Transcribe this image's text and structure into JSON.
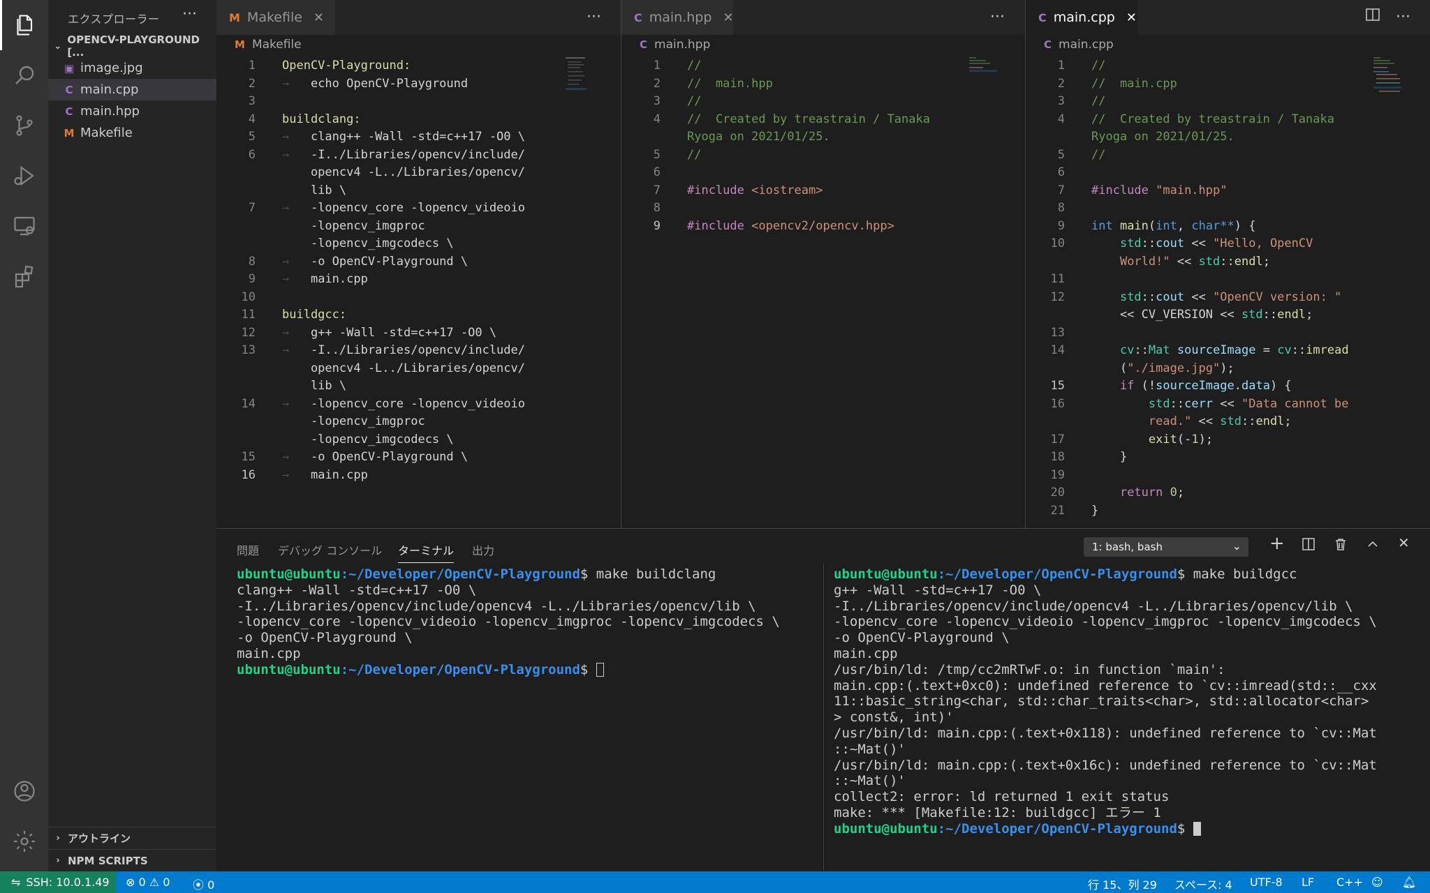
{
  "sidebar": {
    "title": "エクスプローラー",
    "more": "···",
    "folder": "OPENCV-PLAYGROUND [...",
    "files": [
      {
        "name": "image.jpg",
        "icon": "▣",
        "color": "#a074c4"
      },
      {
        "name": "main.cpp",
        "icon": "C",
        "color": "#a074c4"
      },
      {
        "name": "main.hpp",
        "icon": "C",
        "color": "#a074c4"
      },
      {
        "name": "Makefile",
        "icon": "M",
        "color": "#e37933"
      }
    ],
    "sections": [
      "アウトライン",
      "NPM SCRIPTS"
    ]
  },
  "editors": {
    "g1": {
      "tab": "Makefile",
      "tab_icon": "M",
      "breadcrumb": "Makefile"
    },
    "g2": {
      "tab": "main.hpp",
      "tab_icon": "C",
      "breadcrumb": "main.hpp"
    },
    "g3": {
      "tab": "main.cpp",
      "tab_icon": "C",
      "breadcrumb": "main.cpp"
    },
    "more": "···",
    "close": "✕"
  },
  "makefile_lines": [
    {
      "n": "1",
      "parts": [
        [
          "k-label",
          "OpenCV-Playground:"
        ]
      ]
    },
    {
      "n": "2",
      "parts": [
        [
          "k-ws",
          "→   "
        ],
        [
          "k-txt",
          "echo OpenCV-Playground"
        ]
      ]
    },
    {
      "n": "3",
      "parts": []
    },
    {
      "n": "4",
      "parts": [
        [
          "k-label",
          "buildclang:"
        ]
      ]
    },
    {
      "n": "5",
      "parts": [
        [
          "k-ws",
          "→   "
        ],
        [
          "k-txt",
          "clang++ -Wall -std=c++17 -O0 \\"
        ]
      ]
    },
    {
      "n": "6",
      "parts": [
        [
          "k-ws",
          "→   "
        ],
        [
          "k-txt",
          "-I../Libraries/opencv/include/"
        ]
      ]
    },
    {
      "n": "",
      "parts": [
        [
          "k-txt",
          "    opencv4 -L../Libraries/opencv/"
        ]
      ]
    },
    {
      "n": "",
      "parts": [
        [
          "k-txt",
          "    lib \\"
        ]
      ]
    },
    {
      "n": "7",
      "parts": [
        [
          "k-ws",
          "→   "
        ],
        [
          "k-txt",
          "-lopencv_core -lopencv_videoio"
        ]
      ]
    },
    {
      "n": "",
      "parts": [
        [
          "k-txt",
          "    -lopencv_imgproc"
        ]
      ]
    },
    {
      "n": "",
      "parts": [
        [
          "k-txt",
          "    -lopencv_imgcodecs \\"
        ]
      ]
    },
    {
      "n": "8",
      "parts": [
        [
          "k-ws",
          "→   "
        ],
        [
          "k-txt",
          "-o OpenCV-Playground \\"
        ]
      ]
    },
    {
      "n": "9",
      "parts": [
        [
          "k-ws",
          "→   "
        ],
        [
          "k-txt",
          "main.cpp"
        ]
      ]
    },
    {
      "n": "10",
      "parts": []
    },
    {
      "n": "11",
      "parts": [
        [
          "k-label",
          "buildgcc:"
        ]
      ]
    },
    {
      "n": "12",
      "parts": [
        [
          "k-ws",
          "→   "
        ],
        [
          "k-txt",
          "g++ -Wall -std=c++17 -O0 \\"
        ]
      ]
    },
    {
      "n": "13",
      "parts": [
        [
          "k-ws",
          "→   "
        ],
        [
          "k-txt",
          "-I../Libraries/opencv/include/"
        ]
      ]
    },
    {
      "n": "",
      "parts": [
        [
          "k-txt",
          "    opencv4 -L../Libraries/opencv/"
        ]
      ]
    },
    {
      "n": "",
      "parts": [
        [
          "k-txt",
          "    lib \\"
        ]
      ]
    },
    {
      "n": "14",
      "parts": [
        [
          "k-ws",
          "→   "
        ],
        [
          "k-txt",
          "-lopencv_core -lopencv_videoio"
        ]
      ]
    },
    {
      "n": "",
      "parts": [
        [
          "k-txt",
          "    -lopencv_imgproc"
        ]
      ]
    },
    {
      "n": "",
      "parts": [
        [
          "k-txt",
          "    -lopencv_imgcodecs \\"
        ]
      ]
    },
    {
      "n": "15",
      "parts": [
        [
          "k-ws",
          "→   "
        ],
        [
          "k-txt",
          "-o OpenCV-Playground \\"
        ]
      ]
    },
    {
      "n": "16",
      "cur": true,
      "parts": [
        [
          "k-ws",
          "→   "
        ],
        [
          "k-txt",
          "main.cpp"
        ]
      ]
    }
  ],
  "hpp_lines": [
    {
      "n": "1",
      "parts": [
        [
          "k-com",
          "//"
        ]
      ]
    },
    {
      "n": "2",
      "parts": [
        [
          "k-com",
          "//  main.hpp"
        ]
      ]
    },
    {
      "n": "3",
      "parts": [
        [
          "k-com",
          "//"
        ]
      ]
    },
    {
      "n": "4",
      "parts": [
        [
          "k-com",
          "//  Created by treastrain / Tanaka"
        ]
      ]
    },
    {
      "n": "",
      "parts": [
        [
          "k-com",
          "Ryoga on 2021/01/25."
        ]
      ]
    },
    {
      "n": "5",
      "parts": [
        [
          "k-com",
          "//"
        ]
      ]
    },
    {
      "n": "6",
      "parts": []
    },
    {
      "n": "7",
      "parts": [
        [
          "k-inc",
          "#include "
        ],
        [
          "k-str",
          "<iostream>"
        ]
      ]
    },
    {
      "n": "8",
      "parts": []
    },
    {
      "n": "9",
      "cur": true,
      "parts": [
        [
          "k-inc",
          "#include "
        ],
        [
          "k-str",
          "<opencv2/opencv.hpp>"
        ]
      ]
    }
  ],
  "cpp_lines": [
    {
      "n": "1",
      "parts": [
        [
          "k-com",
          "//"
        ]
      ]
    },
    {
      "n": "2",
      "parts": [
        [
          "k-com",
          "//  main.cpp"
        ]
      ]
    },
    {
      "n": "3",
      "parts": [
        [
          "k-com",
          "//"
        ]
      ]
    },
    {
      "n": "4",
      "parts": [
        [
          "k-com",
          "//  Created by treastrain / Tanaka"
        ]
      ]
    },
    {
      "n": "",
      "parts": [
        [
          "k-com",
          "Ryoga on 2021/01/25."
        ]
      ]
    },
    {
      "n": "5",
      "parts": [
        [
          "k-com",
          "//"
        ]
      ]
    },
    {
      "n": "6",
      "parts": []
    },
    {
      "n": "7",
      "parts": [
        [
          "k-inc",
          "#include "
        ],
        [
          "k-str",
          "\"main.hpp\""
        ]
      ]
    },
    {
      "n": "8",
      "parts": []
    },
    {
      "n": "9",
      "parts": [
        [
          "k-type",
          "int "
        ],
        [
          "k-label",
          "main"
        ],
        [
          "k-txt",
          "("
        ],
        [
          "k-type",
          "int"
        ],
        [
          "k-txt",
          ", "
        ],
        [
          "k-type",
          "char**"
        ],
        [
          "k-txt",
          ") {"
        ]
      ]
    },
    {
      "n": "10",
      "parts": [
        [
          "k-txt",
          "    "
        ],
        [
          "k-ns",
          "std"
        ],
        [
          "k-txt",
          "::"
        ],
        [
          "k-var",
          "cout"
        ],
        [
          "k-txt",
          " << "
        ],
        [
          "k-str",
          "\"Hello, OpenCV"
        ]
      ]
    },
    {
      "n": "",
      "parts": [
        [
          "k-txt",
          "    "
        ],
        [
          "k-str",
          "World!\""
        ],
        [
          "k-txt",
          " << "
        ],
        [
          "k-ns",
          "std"
        ],
        [
          "k-txt",
          "::"
        ],
        [
          "k-label",
          "endl"
        ],
        [
          "k-txt",
          ";"
        ]
      ]
    },
    {
      "n": "11",
      "parts": []
    },
    {
      "n": "12",
      "parts": [
        [
          "k-txt",
          "    "
        ],
        [
          "k-ns",
          "std"
        ],
        [
          "k-txt",
          "::"
        ],
        [
          "k-var",
          "cout"
        ],
        [
          "k-txt",
          " << "
        ],
        [
          "k-str",
          "\"OpenCV version: \""
        ]
      ]
    },
    {
      "n": "",
      "parts": [
        [
          "k-txt",
          "    << CV_VERSION << "
        ],
        [
          "k-ns",
          "std"
        ],
        [
          "k-txt",
          "::"
        ],
        [
          "k-label",
          "endl"
        ],
        [
          "k-txt",
          ";"
        ]
      ]
    },
    {
      "n": "13",
      "parts": []
    },
    {
      "n": "14",
      "parts": [
        [
          "k-txt",
          "    "
        ],
        [
          "k-ns",
          "cv"
        ],
        [
          "k-txt",
          "::"
        ],
        [
          "k-ns",
          "Mat"
        ],
        [
          "k-txt",
          " "
        ],
        [
          "k-var",
          "sourceImage"
        ],
        [
          "k-txt",
          " = "
        ],
        [
          "k-ns",
          "cv"
        ],
        [
          "k-txt",
          "::"
        ],
        [
          "k-label",
          "imread"
        ]
      ]
    },
    {
      "n": "",
      "parts": [
        [
          "k-txt",
          "    ("
        ],
        [
          "k-str",
          "\"./image.jpg\""
        ],
        [
          "k-txt",
          ");"
        ]
      ]
    },
    {
      "n": "15",
      "cur": true,
      "parts": [
        [
          "k-txt",
          "    "
        ],
        [
          "k-inc",
          "if"
        ],
        [
          "k-txt",
          " (!"
        ],
        [
          "k-var",
          "sourceImage"
        ],
        [
          "k-txt",
          "."
        ],
        [
          "k-var",
          "data"
        ],
        [
          "k-txt",
          ") {"
        ]
      ]
    },
    {
      "n": "16",
      "parts": [
        [
          "k-txt",
          "        "
        ],
        [
          "k-ns",
          "std"
        ],
        [
          "k-txt",
          "::"
        ],
        [
          "k-var",
          "cerr"
        ],
        [
          "k-txt",
          " << "
        ],
        [
          "k-str",
          "\"Data cannot be"
        ]
      ]
    },
    {
      "n": "",
      "parts": [
        [
          "k-txt",
          "        "
        ],
        [
          "k-str",
          "read.\""
        ],
        [
          "k-txt",
          " << "
        ],
        [
          "k-ns",
          "std"
        ],
        [
          "k-txt",
          "::"
        ],
        [
          "k-label",
          "endl"
        ],
        [
          "k-txt",
          ";"
        ]
      ]
    },
    {
      "n": "17",
      "parts": [
        [
          "k-txt",
          "        "
        ],
        [
          "k-label",
          "exit"
        ],
        [
          "k-txt",
          "(-"
        ],
        [
          "k-num",
          "1"
        ],
        [
          "k-txt",
          ");"
        ]
      ]
    },
    {
      "n": "18",
      "parts": [
        [
          "k-txt",
          "    }"
        ]
      ]
    },
    {
      "n": "19",
      "parts": []
    },
    {
      "n": "20",
      "parts": [
        [
          "k-txt",
          "    "
        ],
        [
          "k-inc",
          "return"
        ],
        [
          "k-txt",
          " "
        ],
        [
          "k-num",
          "0"
        ],
        [
          "k-txt",
          ";"
        ]
      ]
    },
    {
      "n": "21",
      "parts": [
        [
          "k-txt",
          "}"
        ]
      ]
    }
  ],
  "panel": {
    "tabs": [
      "問題",
      "デバッグ コンソール",
      "ターミナル",
      "出力"
    ],
    "select": "1: bash, bash",
    "add": "+",
    "split": "◫",
    "trash": "🗑",
    "maximize": "⌃",
    "close": "✕"
  },
  "terminal_left": [
    {
      "user": "ubuntu@ubuntu",
      "path": ":~/Developer/OpenCV-Playground",
      "cmd": "$ make buildclang"
    },
    {
      "text": "clang++ -Wall -std=c++17 -O0 \\"
    },
    {
      "text": "-I../Libraries/opencv/include/opencv4 -L../Libraries/opencv/lib \\"
    },
    {
      "text": "-lopencv_core -lopencv_videoio -lopencv_imgproc -lopencv_imgcodecs \\"
    },
    {
      "text": "-o OpenCV-Playground \\"
    },
    {
      "text": "main.cpp"
    },
    {
      "user": "ubuntu@ubuntu",
      "path": ":~/Developer/OpenCV-Playground",
      "cmd": "$ ",
      "cursor": "box"
    }
  ],
  "terminal_right": [
    {
      "user": "ubuntu@ubuntu",
      "path": ":~/Developer/OpenCV-Playground",
      "cmd": "$ make buildgcc"
    },
    {
      "text": "g++ -Wall -std=c++17 -O0 \\"
    },
    {
      "text": "-I../Libraries/opencv/include/opencv4 -L../Libraries/opencv/lib \\"
    },
    {
      "text": "-lopencv_core -lopencv_videoio -lopencv_imgproc -lopencv_imgcodecs \\"
    },
    {
      "text": "-o OpenCV-Playground \\"
    },
    {
      "text": "main.cpp"
    },
    {
      "text": "/usr/bin/ld: /tmp/cc2mRTwF.o: in function `main':"
    },
    {
      "text": "main.cpp:(.text+0xc0): undefined reference to `cv::imread(std::__cxx"
    },
    {
      "text": "11::basic_string<char, std::char_traits<char>, std::allocator<char>"
    },
    {
      "text": "> const&, int)'"
    },
    {
      "text": "/usr/bin/ld: main.cpp:(.text+0x118): undefined reference to `cv::Mat"
    },
    {
      "text": "::~Mat()'"
    },
    {
      "text": "/usr/bin/ld: main.cpp:(.text+0x16c): undefined reference to `cv::Mat"
    },
    {
      "text": "::~Mat()'"
    },
    {
      "text": "collect2: error: ld returned 1 exit status"
    },
    {
      "text": "make: *** [Makefile:12: buildgcc] エラー 1"
    },
    {
      "user": "ubuntu@ubuntu",
      "path": ":~/Developer/OpenCV-Playground",
      "cmd": "$ ",
      "cursor": "fill"
    }
  ],
  "status": {
    "remote": "SSH: 10.0.1.49",
    "errors": "0",
    "warnings": "0",
    "ports": "0",
    "position": "行 15、列 29",
    "spaces": "スペース: 4",
    "encoding": "UTF-8",
    "eol": "LF",
    "language": "C++"
  },
  "colors": {
    "accent": "#007acc",
    "remote": "#16825d"
  }
}
